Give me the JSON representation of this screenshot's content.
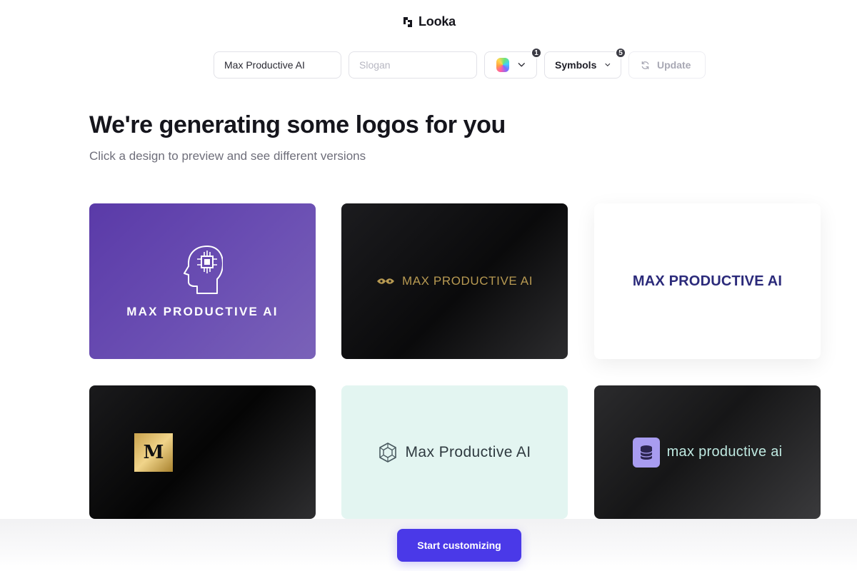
{
  "header": {
    "brand": "Looka"
  },
  "toolbar": {
    "name_value": "Max Productive AI",
    "slogan_placeholder": "Slogan",
    "colors_count": "1",
    "symbols_label": "Symbols",
    "symbols_count": "5",
    "update_label": "Update"
  },
  "main": {
    "title": "We're generating some logos for you",
    "subtitle": "Click a design to preview and see different versions"
  },
  "logos": [
    {
      "text": "MAX PRODUCTIVE AI",
      "icon": "brain-chip-icon"
    },
    {
      "text": "MAX PRODUCTIVE AI",
      "icon": "gold-wings-icon"
    },
    {
      "text": "MAX PRODUCTIVE AI",
      "icon": ""
    },
    {
      "text": "",
      "icon": "monogram-badge",
      "monogram": "M"
    },
    {
      "text": "Max Productive AI",
      "icon": "hexagon-cube-icon"
    },
    {
      "text": "max productive ai",
      "icon": "database-icon"
    }
  ],
  "cta": {
    "label": "Start customizing"
  },
  "colors": {
    "accent": "#4a39e8",
    "purple_card": "#6b4fb3",
    "mint_card": "#e3f5f1",
    "navy_text": "#2b2a7a"
  }
}
